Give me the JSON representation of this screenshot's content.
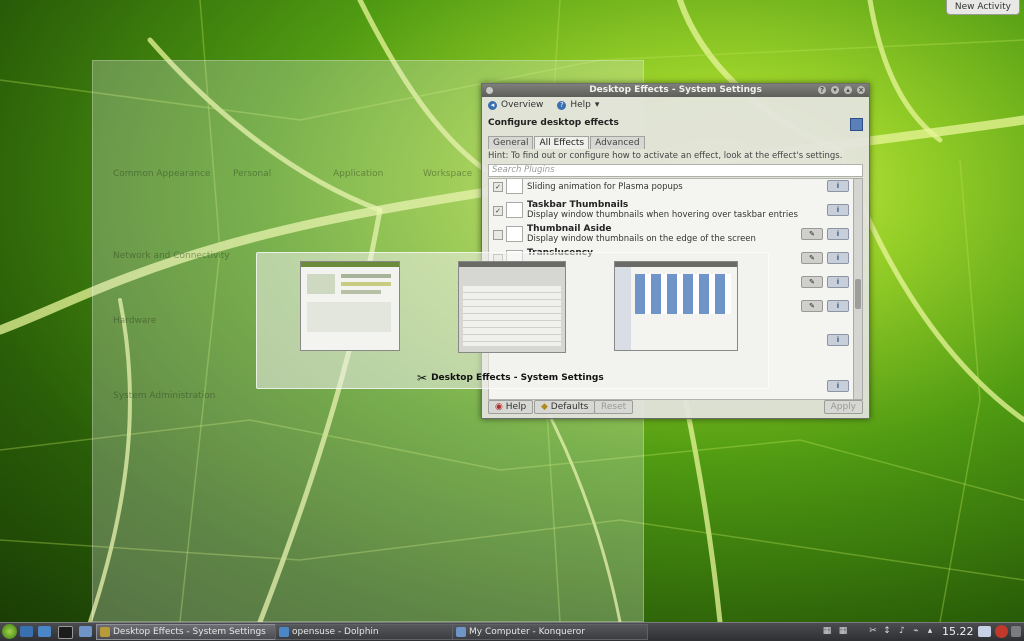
{
  "desktop": {
    "new_activity_label": "New Activity"
  },
  "ghost_window": {
    "labels": [
      "Common Appearance",
      "Personal",
      "Application",
      "Workspace",
      "Network and Connectivity",
      "Hardware",
      "System Administration"
    ]
  },
  "settings_window": {
    "title": "Desktop Effects - System Settings",
    "toolbar": {
      "overview": "Overview",
      "help": "Help"
    },
    "heading": "Configure desktop effects",
    "tabs": [
      "General",
      "All Effects",
      "Advanced"
    ],
    "active_tab": "All Effects",
    "hint": "Hint: To find out or configure how to activate an effect, look at the effect's settings.",
    "search_placeholder": "Search Plugins",
    "plugins": [
      {
        "name": "",
        "desc": "Sliding animation for Plasma popups",
        "checked": true,
        "configurable": false
      },
      {
        "name": "Taskbar Thumbnails",
        "desc": "Display window thumbnails when hovering over taskbar entries",
        "checked": true,
        "configurable": false
      },
      {
        "name": "Thumbnail Aside",
        "desc": "Display window thumbnails on the edge of the screen",
        "checked": false,
        "configurable": true
      },
      {
        "name": "Translucency",
        "desc": "",
        "checked": false,
        "configurable": true
      }
    ],
    "buttons": {
      "help": "Help",
      "defaults": "Defaults",
      "reset": "Reset",
      "apply": "Apply"
    }
  },
  "switcher": {
    "current_label": "Desktop Effects - System Settings"
  },
  "taskbar": {
    "tasks": [
      {
        "label": "Desktop Effects - System Settings",
        "active": true
      },
      {
        "label": "opensuse - Dolphin",
        "active": false
      },
      {
        "label": "My Computer - Konqueror",
        "active": false
      }
    ],
    "clock": "15.22"
  },
  "colors": {
    "leaf_light": "#d6f05a",
    "leaf_dark": "#1a3d05",
    "panel": "#3a3c3f",
    "accent": "#3a6fb0"
  }
}
